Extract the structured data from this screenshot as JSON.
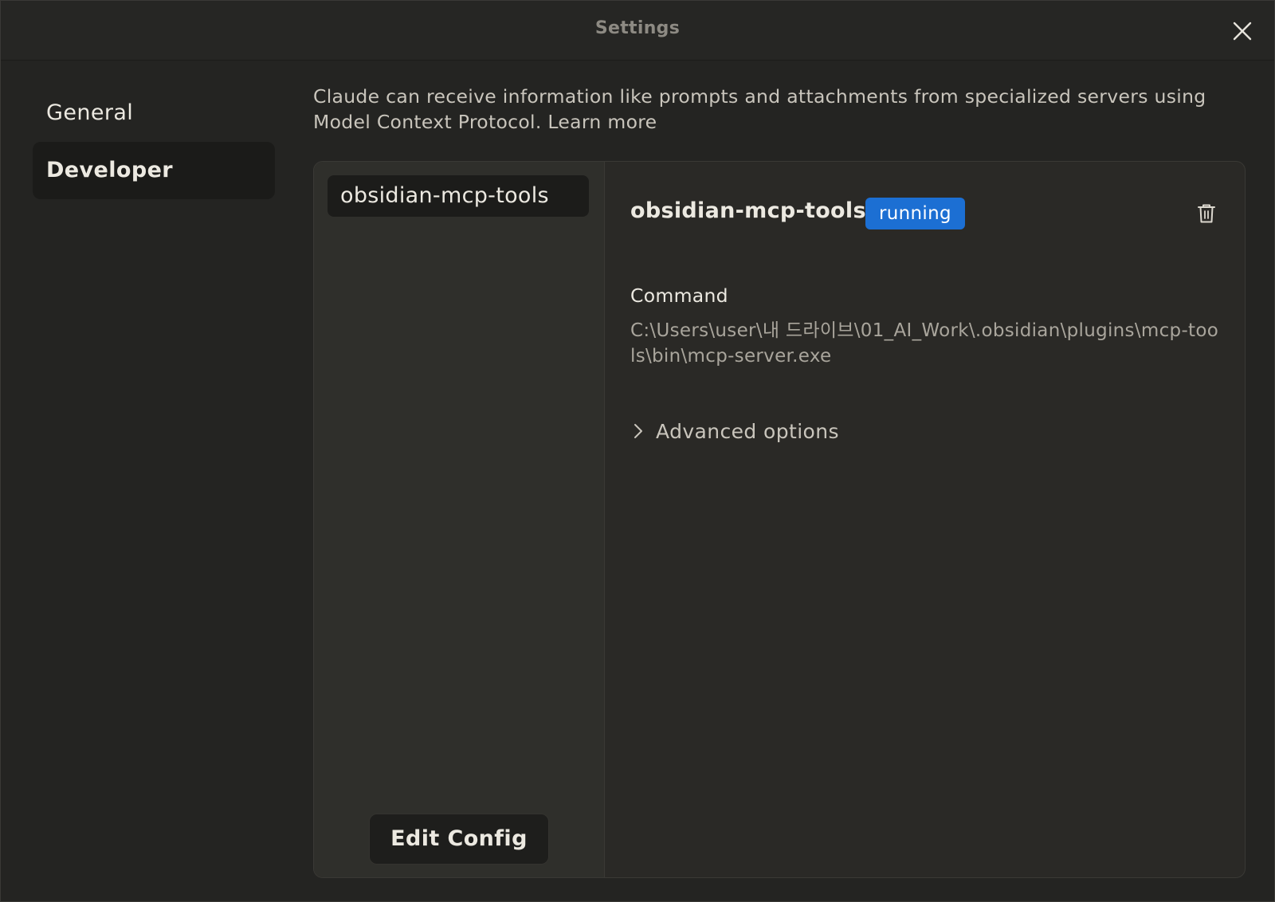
{
  "window": {
    "title": "Settings",
    "close_icon": "close-icon"
  },
  "sidebar": {
    "items": [
      {
        "label": "General",
        "active": false
      },
      {
        "label": "Developer",
        "active": true
      }
    ]
  },
  "intro": {
    "text": "Claude can receive information like prompts and attachments from specialized servers using Model Context Protocol.",
    "learn_more": "Learn more"
  },
  "servers": {
    "list": [
      {
        "name": "obsidian-mcp-tools"
      }
    ],
    "edit_config_label": "Edit Config"
  },
  "detail": {
    "name": "obsidian-mcp-tools",
    "status": "running",
    "status_color": "#1c6fd3",
    "delete_icon": "trash-icon",
    "command_label": "Command",
    "command_value": "C:\\Users\\user\\내 드라이브\\01_AI_Work\\.obsidian\\plugins\\mcp-tools\\bin\\mcp-server.exe",
    "advanced_label": "Advanced options",
    "advanced_icon": "chevron-right-icon"
  }
}
